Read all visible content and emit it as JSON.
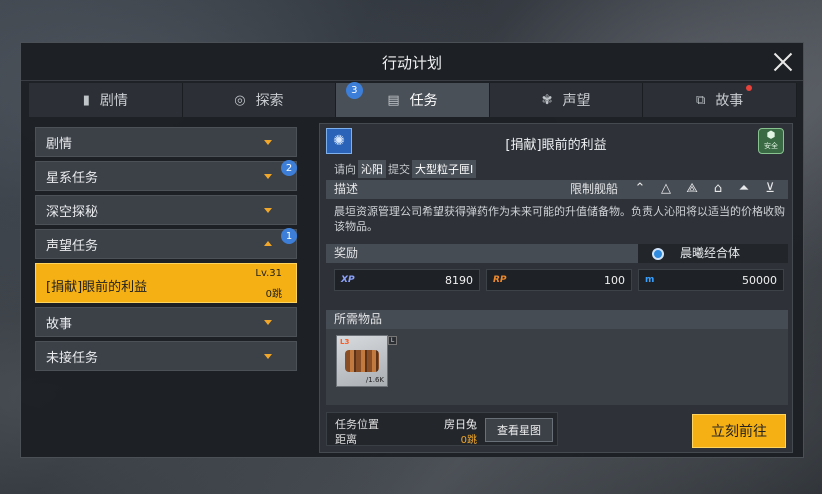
{
  "window": {
    "title": "行动计划"
  },
  "tabs": [
    {
      "label": "剧情",
      "icon": "book-icon"
    },
    {
      "label": "探索",
      "icon": "explore-icon"
    },
    {
      "label": "任务",
      "icon": "clipboard-icon",
      "badge": "3"
    },
    {
      "label": "声望",
      "icon": "reputation-icon"
    },
    {
      "label": "故事",
      "icon": "story-icon"
    }
  ],
  "sidebar": {
    "items": [
      {
        "label": "剧情"
      },
      {
        "label": "星系任务",
        "badge": "2"
      },
      {
        "label": "深空探秘"
      },
      {
        "label": "声望任务",
        "badge": "1"
      },
      {
        "label": "故事"
      },
      {
        "label": "未接任务"
      }
    ],
    "selected": {
      "label": "[捐献]眼前的利益",
      "level": "Lv.31",
      "jumps": "0跳"
    }
  },
  "mission": {
    "title": "[捐献]眼前的利益",
    "safety_label": "安全",
    "request_prefix": "请向",
    "npc": "沁阳",
    "submit_label": "提交",
    "item_name": "大型粒子匣Ⅰ",
    "desc_header": "描述",
    "ship_limit_label": "限制舰船",
    "description": "晨垣资源管理公司希望获得弹药作为未来可能的升值储备物。负责人沁阳将以适当的价格收购该物品。",
    "reward_header": "奖励",
    "faction": "晨曦经合体",
    "rewards": [
      {
        "key": "XP",
        "value": "8190"
      },
      {
        "key": "RP",
        "value": "100"
      },
      {
        "key": "m",
        "value": "50000"
      }
    ],
    "items_header": "所需物品",
    "item_tag": "L3",
    "item_level": "L",
    "item_qty": "/1.6K",
    "location_label": "任务位置",
    "location_value": "房日兔",
    "distance_label": "距离",
    "distance_value": "0跳",
    "map_button": "查看星图",
    "go_button": "立刻前往"
  }
}
